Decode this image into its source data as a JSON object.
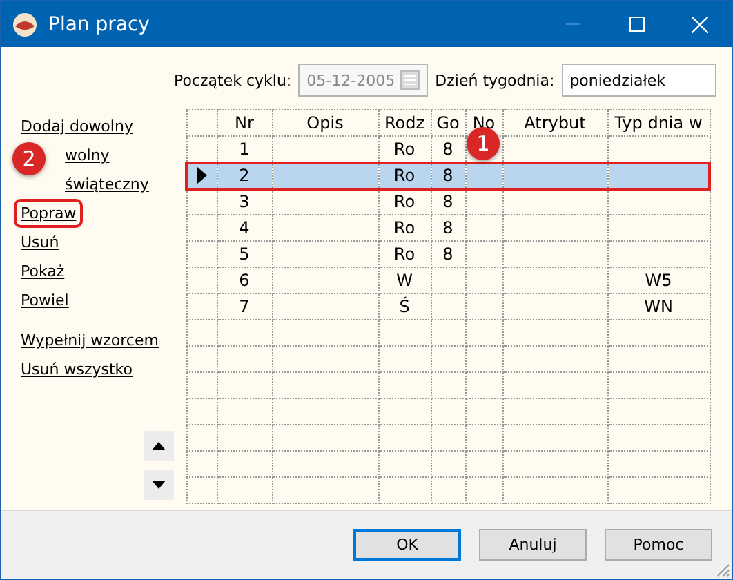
{
  "window": {
    "title": "Plan pracy"
  },
  "cycle_start": {
    "label": "Początek cyklu:",
    "value": "05-12-2005",
    "disabled": true
  },
  "weekday": {
    "label": "Dzień tygodnia:",
    "value": "poniedziałek"
  },
  "action_groups": [
    [
      {
        "label": "Dodaj dowolny",
        "indented": false,
        "highlighted": false
      },
      {
        "label": "wolny",
        "indented": true,
        "highlighted": false
      },
      {
        "label": "świąteczny",
        "indented": true,
        "highlighted": false
      },
      {
        "label": "Popraw",
        "indented": false,
        "highlighted": true
      },
      {
        "label": "Usuń",
        "indented": false,
        "highlighted": false
      },
      {
        "label": "Pokaż",
        "indented": false,
        "highlighted": false
      },
      {
        "label": "Powiel",
        "indented": false,
        "highlighted": false
      }
    ],
    [
      {
        "label": "Wypełnij wzorcem",
        "indented": false,
        "highlighted": false
      },
      {
        "label": "Usuń wszystko",
        "indented": false,
        "highlighted": false
      }
    ]
  ],
  "table": {
    "columns": [
      "Nr",
      "Opis",
      "Rodz",
      "Go",
      "No",
      "Atrybut",
      "Typ dnia w"
    ],
    "rows": [
      {
        "cells": [
          "1",
          "",
          "Ro",
          "8",
          "",
          "",
          ""
        ],
        "selected": false,
        "highlighted": false
      },
      {
        "cells": [
          "2",
          "",
          "Ro",
          "8",
          "",
          "",
          ""
        ],
        "selected": true,
        "highlighted": true
      },
      {
        "cells": [
          "3",
          "",
          "Ro",
          "8",
          "",
          "",
          ""
        ],
        "selected": false,
        "highlighted": false
      },
      {
        "cells": [
          "4",
          "",
          "Ro",
          "8",
          "",
          "",
          ""
        ],
        "selected": false,
        "highlighted": false
      },
      {
        "cells": [
          "5",
          "",
          "Ro",
          "8",
          "",
          "",
          ""
        ],
        "selected": false,
        "highlighted": false
      },
      {
        "cells": [
          "6",
          "",
          "W",
          "",
          "",
          "",
          "W5"
        ],
        "selected": false,
        "highlighted": false
      },
      {
        "cells": [
          "7",
          "",
          "Ś",
          "",
          "",
          "",
          "WN"
        ],
        "selected": false,
        "highlighted": false
      }
    ]
  },
  "callouts": [
    "1",
    "2"
  ],
  "buttons": [
    "OK",
    "Anuluj",
    "Pomoc"
  ]
}
